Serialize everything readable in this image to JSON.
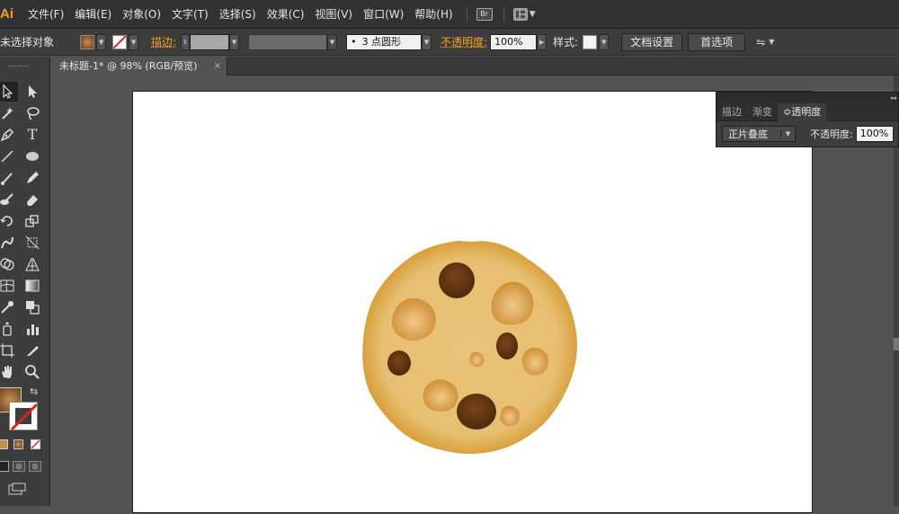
{
  "app": {
    "logo": "Ai"
  },
  "menu": [
    "文件(F)",
    "编辑(E)",
    "对象(O)",
    "文字(T)",
    "选择(S)",
    "效果(C)",
    "视图(V)",
    "窗口(W)",
    "帮助(H)"
  ],
  "menu_icons": {
    "bridge_label": "Br"
  },
  "control_bar": {
    "selection_status": "未选择对象",
    "stroke_label": "描边:",
    "brush_value": "3 点圆形",
    "brush_dot": "•",
    "opacity_label": "不透明度:",
    "opacity_value": "100%",
    "style_label": "样式:",
    "doc_setup_button": "文档设置",
    "preferences_button": "首选项"
  },
  "document_tab": {
    "title": "未标题-1* @ 98% (RGB/预览)",
    "close": "×"
  },
  "panel": {
    "collapse": "◂◂",
    "tabs": [
      "描边",
      "渐变",
      "≎透明度"
    ],
    "blend_mode": "正片叠底",
    "opacity_label": "不透明度:",
    "opacity_value": "100%"
  },
  "colors": {
    "accent_orange": "#f7a21b",
    "cookie_base": "#e8c070",
    "cookie_edge": "#d8a040",
    "chip_dark": "#6b3a12"
  },
  "icons": [
    "selection-tool-icon",
    "direct-selection-tool-icon",
    "magic-wand-icon",
    "lasso-icon",
    "pen-tool-icon",
    "type-tool-icon",
    "line-tool-icon",
    "ellipse-tool-icon",
    "paintbrush-icon",
    "pencil-icon",
    "blob-brush-icon",
    "eraser-icon",
    "rotate-tool-icon",
    "scale-tool-icon",
    "warp-tool-icon",
    "free-transform-icon",
    "shape-builder-icon",
    "perspective-grid-icon",
    "mesh-tool-icon",
    "gradient-tool-icon",
    "eyedropper-icon",
    "blend-tool-icon",
    "symbol-sprayer-icon",
    "column-graph-icon",
    "artboard-tool-icon",
    "slice-tool-icon",
    "hand-tool-icon",
    "zoom-tool-icon"
  ]
}
